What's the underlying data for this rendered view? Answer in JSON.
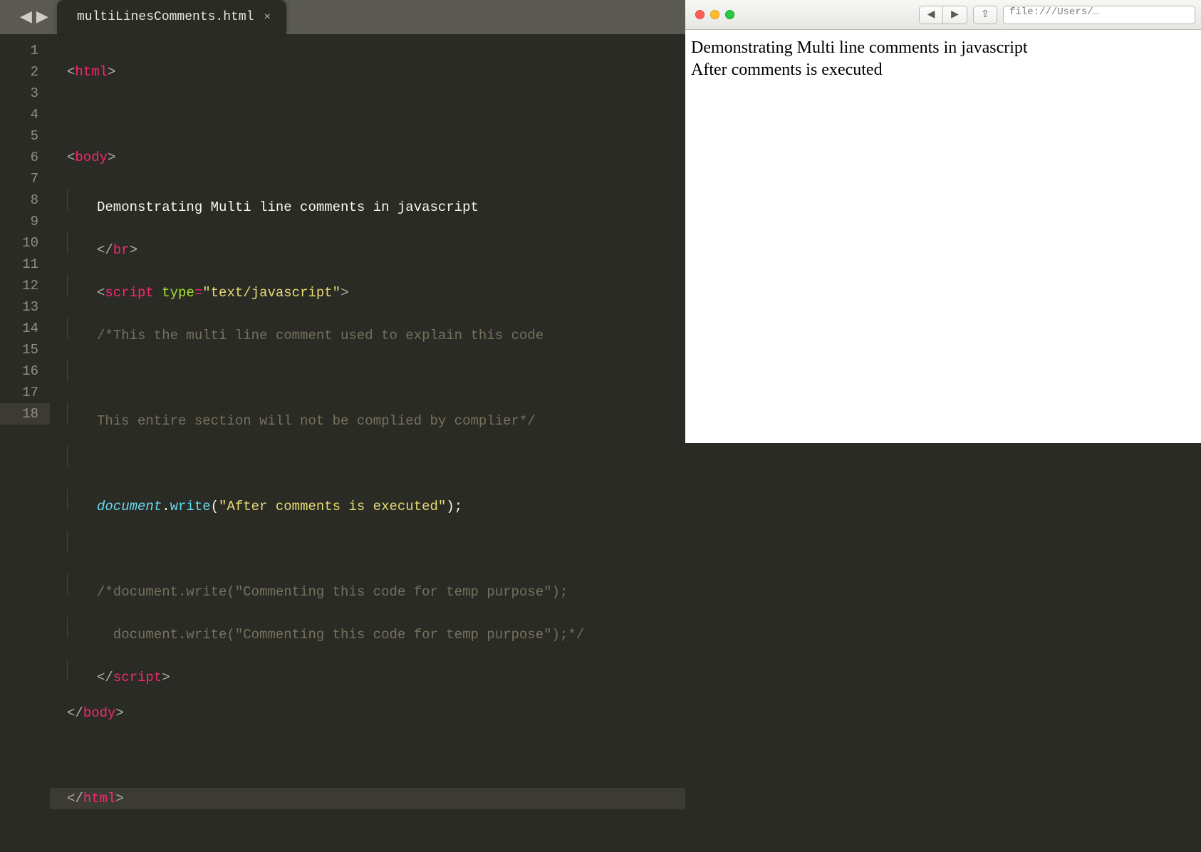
{
  "editor": {
    "nav": {
      "back": "◀",
      "forward": "▶"
    },
    "tab": {
      "label": "multiLinesComments.html",
      "close": "×"
    },
    "lineNumbers": [
      "1",
      "2",
      "3",
      "4",
      "5",
      "6",
      "7",
      "8",
      "9",
      "10",
      "11",
      "12",
      "13",
      "14",
      "15",
      "16",
      "17",
      "18"
    ],
    "activeLine": 18,
    "code": {
      "l1": {
        "open": "<",
        "tag": "html",
        "close": ">"
      },
      "l3": {
        "open": "<",
        "tag": "body",
        "close": ">"
      },
      "l4": {
        "text": "Demonstrating Multi line comments in javascript"
      },
      "l5": {
        "open": "</",
        "tag": "br",
        "close": ">"
      },
      "l6": {
        "open": "<",
        "tag": "script",
        "sp": " ",
        "attr": "type",
        "eq": "=",
        "val": "\"text/javascript\"",
        "close": ">"
      },
      "l7": {
        "text": "/*This the multi line comment used to explain this code"
      },
      "l9": {
        "text": "This entire section will not be complied by complier*/"
      },
      "l11": {
        "obj": "document",
        "dot": ".",
        "fn": "write",
        "lp": "(",
        "arg": "\"After comments is executed\"",
        "rp": ")",
        "semi": ";"
      },
      "l13": {
        "text": "/*document.write(\"Commenting this code for temp purpose\");"
      },
      "l14": {
        "text": "  document.write(\"Commenting this code for temp purpose\");*/"
      },
      "l15": {
        "open": "</",
        "tag": "script",
        "close": ">"
      },
      "l16": {
        "open": "</",
        "tag": "body",
        "close": ">"
      },
      "l18": {
        "open": "</",
        "tag": "html",
        "close": ">"
      }
    }
  },
  "browser": {
    "nav": {
      "back": "◀",
      "forward": "▶"
    },
    "share": "⇪",
    "url": "file:///Users/…",
    "output": {
      "line1": "Demonstrating Multi line comments in javascript",
      "line2": "After comments is executed"
    }
  }
}
